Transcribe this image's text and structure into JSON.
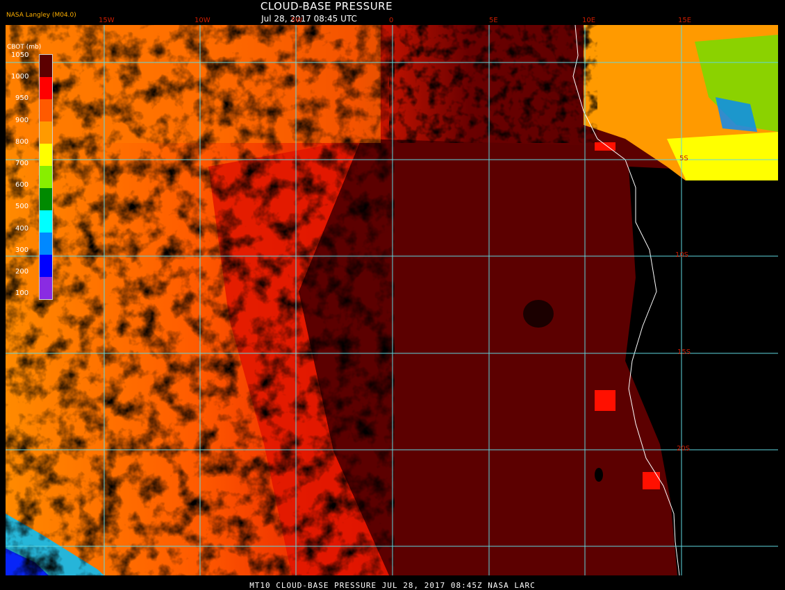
{
  "header": {
    "title": "CLOUD-BASE PRESSURE",
    "subtitle": "Jul 28, 2017 08:45 UTC",
    "credit": "NASA Langley (M04.0)"
  },
  "footer": {
    "text": "MT10  CLOUD-BASE PRESSURE   JUL 28, 2017 08:45Z   NASA LARC"
  },
  "legend": {
    "title": "CBOT (mb)",
    "ticks": [
      "1050",
      "1000",
      "950",
      "900",
      "800",
      "700",
      "600",
      "500",
      "400",
      "300",
      "200",
      "100"
    ],
    "colors": [
      "#5c0000",
      "#ff0000",
      "#ff5a00",
      "#ff9a00",
      "#ffff00",
      "#88ee00",
      "#008a00",
      "#00ffff",
      "#0088ff",
      "#0000ff",
      "#8a2be2"
    ]
  },
  "grid": {
    "lon_labels": [
      "15W",
      "10W",
      "5W",
      "0",
      "5E",
      "10E",
      "15E"
    ],
    "lat_labels": [
      "5S",
      "10S",
      "15S",
      "20S"
    ]
  },
  "colors": {
    "grid_line": "#5fd8e0",
    "label_red": "#cc1c00"
  }
}
